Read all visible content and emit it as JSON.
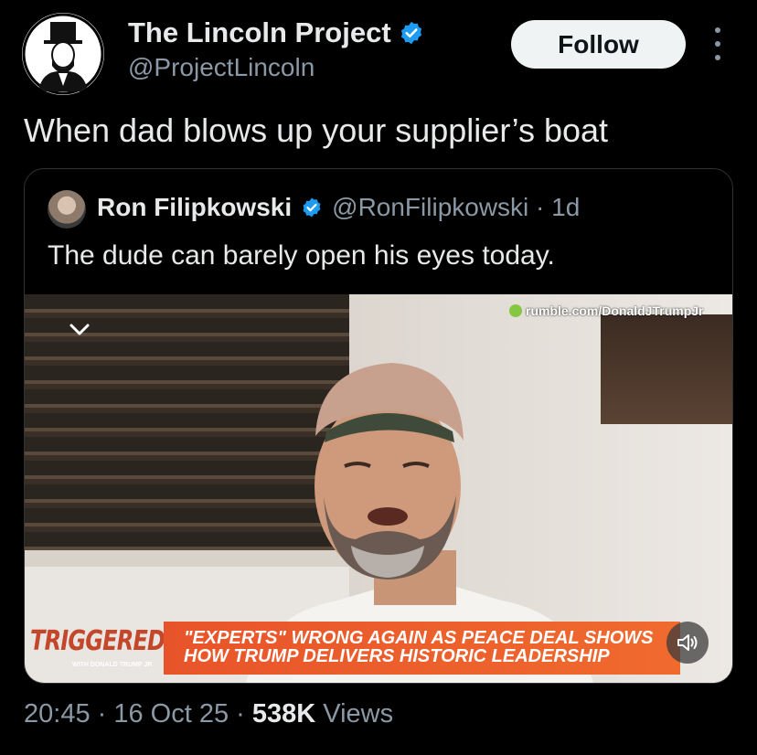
{
  "author": {
    "name": "The Lincoln Project",
    "handle": "@ProjectLincoln",
    "avatar_icon": "lincoln-portrait-logo",
    "verified_icon": "verified-badge-icon"
  },
  "follow_button": {
    "label": "Follow"
  },
  "more_icon": "more-options-icon",
  "tweet": {
    "text": "When dad blows up your supplier’s boat"
  },
  "quote": {
    "name": "Ron Filipkowski",
    "handle": "@RonFilipkowski · 1d",
    "text": "The dude can barely open his eyes today.",
    "video": {
      "watermark": "rumble.com/DonaldJTrumpJr",
      "show_logo": "TRIGGERED",
      "show_sub": "WITH DONALD TRUMP JR",
      "lower_third_line1": "\"EXPERTS\" WRONG AGAIN AS PEACE DEAL SHOWS",
      "lower_third_line2": "HOW TRUMP DELIVERS HISTORIC LEADERSHIP",
      "speaker_icon": "volume-icon",
      "chevron_icon": "chevron-down-icon"
    }
  },
  "meta": {
    "time_date": "20:45 · 16 Oct 25 · ",
    "views_count": "538K",
    "views_label": " Views"
  },
  "colors": {
    "background": "#000000",
    "verified": "#1d9bf0",
    "muted": "#8b98a5",
    "banner": "#e8542a"
  }
}
